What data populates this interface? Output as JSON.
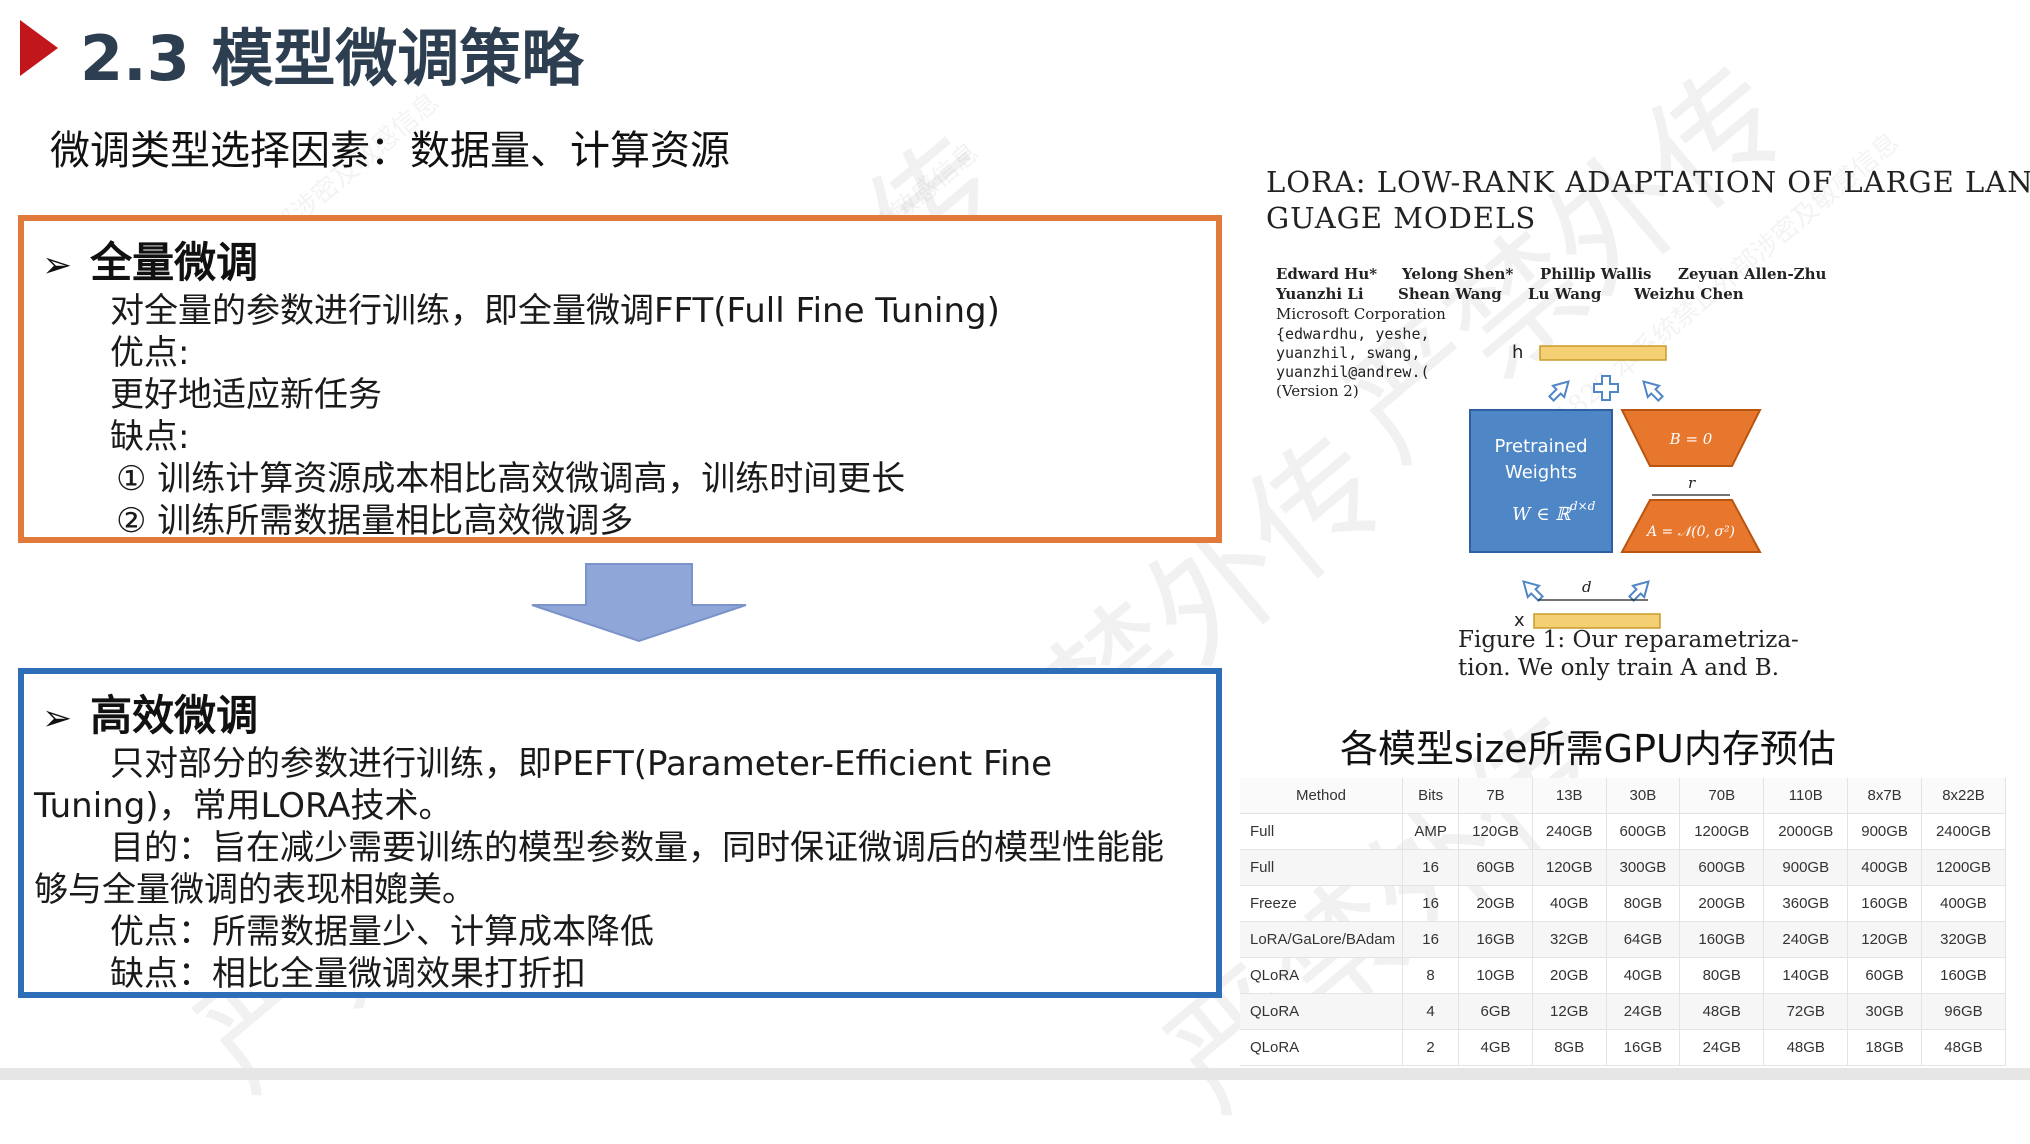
{
  "header": {
    "title": "2.3 模型微调策略",
    "subtitle": "微调类型选择因素：数据量、计算资源"
  },
  "full_box": {
    "heading": "全量微调",
    "lines": [
      "对全量的参数进行训练，即全量微调FFT(Full Fine Tuning)",
      "优点:",
      " 更好地适应新任务",
      "缺点:",
      "① 训练计算资源成本相比高效微调高，训练时间更长",
      "② 训练所需数据量相比高效微调多"
    ]
  },
  "efficient_box": {
    "heading": "高效微调",
    "lines": [
      "只对部分的参数进行训练，即PEFT(Parameter-Efficient Fine",
      "Tuning)，常用LORA技术。",
      "目的：旨在减少需要训练的模型参数量，同时保证微调后的模型性能能",
      "够与全量微调的表现相媲美。",
      "优点：所需数据量少、计算成本降低",
      "缺点：相比全量微调效果打折扣"
    ]
  },
  "paper": {
    "title_line1": "LORA: LOW-RANK ADAPTATION OF LARGE LAN-",
    "title_line2": "GUAGE MODELS",
    "authors_row1": [
      "Edward Hu*",
      "Yelong Shen*",
      "Phillip Wallis",
      "Zeyuan Allen-Zhu"
    ],
    "authors_row2": [
      "Yuanzhi Li",
      "Shean Wang",
      "Lu Wang",
      "Weizhu Chen"
    ],
    "affiliation": "Microsoft Corporation",
    "emails": [
      "{edwardhu, yeshe,",
      "yuanzhil, swang,",
      "yuanzhil@andrew.("
    ],
    "version": "(Version 2)",
    "figure": {
      "h_label": "h",
      "x_label": "x",
      "r_label": "r",
      "d_label": "d",
      "pretrained_line1": "Pretrained",
      "pretrained_line2": "Weights",
      "w_formula": "W ∈ ℝ",
      "w_sup": "d×d",
      "b_formula": "B = 0",
      "a_formula": "A = 𝒩(0, σ²)"
    },
    "caption_line1": "Figure 1: Our reparametriza-",
    "caption_line2": "tion. We only train A and B."
  },
  "gpu_table": {
    "title": "各模型size所需GPU内存预估",
    "columns": [
      "Method",
      "Bits",
      "7B",
      "13B",
      "30B",
      "70B",
      "110B",
      "8x7B",
      "8x22B"
    ],
    "rows": [
      [
        "Full",
        "AMP",
        "120GB",
        "240GB",
        "600GB",
        "1200GB",
        "2000GB",
        "900GB",
        "2400GB"
      ],
      [
        "Full",
        "16",
        "60GB",
        "120GB",
        "300GB",
        "600GB",
        "900GB",
        "400GB",
        "1200GB"
      ],
      [
        "Freeze",
        "16",
        "20GB",
        "40GB",
        "80GB",
        "200GB",
        "360GB",
        "160GB",
        "400GB"
      ],
      [
        "LoRA/GaLore/BAdam",
        "16",
        "16GB",
        "32GB",
        "64GB",
        "160GB",
        "240GB",
        "120GB",
        "320GB"
      ],
      [
        "QLoRA",
        "8",
        "10GB",
        "20GB",
        "40GB",
        "80GB",
        "140GB",
        "60GB",
        "160GB"
      ],
      [
        "QLoRA",
        "4",
        "6GB",
        "12GB",
        "24GB",
        "48GB",
        "72GB",
        "30GB",
        "96GB"
      ],
      [
        "QLoRA",
        "2",
        "4GB",
        "8GB",
        "16GB",
        "24GB",
        "48GB",
        "18GB",
        "48GB"
      ]
    ]
  },
  "watermark": {
    "big": "严禁外传",
    "small": "吴生骸 1826 本系统禁止外部涉密及敏感信息"
  },
  "colors": {
    "accent_red": "#c0161c",
    "full_border": "#e27a3b",
    "efficient_border": "#2e6db7",
    "arrow_fill": "#8ea6d8",
    "pretrained_fill": "#4f86c6",
    "lora_fill": "#e8772e",
    "hx_fill": "#f4cf73"
  }
}
